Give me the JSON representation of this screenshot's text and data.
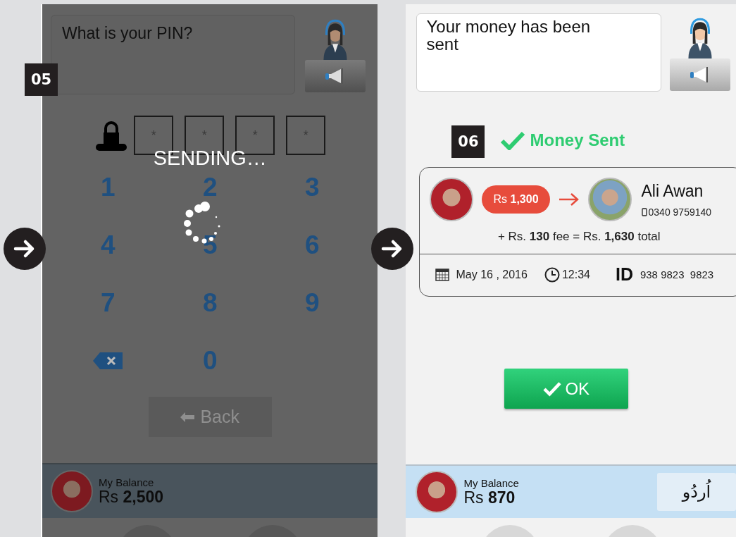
{
  "pin_screen": {
    "step": "05",
    "loading": true,
    "loading_text": "SENDING…",
    "message": "What is your PIN?",
    "pin_digits": [
      "*",
      "*",
      "*",
      "*"
    ],
    "keypad": [
      {
        "kind": "digit",
        "label": "1"
      },
      {
        "kind": "digit",
        "label": "2"
      },
      {
        "kind": "digit",
        "label": "3"
      },
      {
        "kind": "digit",
        "label": "4"
      },
      {
        "kind": "digit",
        "label": "5"
      },
      {
        "kind": "digit",
        "label": "6"
      },
      {
        "kind": "digit",
        "label": "7"
      },
      {
        "kind": "digit",
        "label": "8"
      },
      {
        "kind": "digit",
        "label": "9"
      },
      {
        "kind": "delete"
      },
      {
        "kind": "digit",
        "label": "0"
      }
    ],
    "back_button": {
      "label": "Back",
      "disabled": true
    },
    "balance": {
      "label": "My Balance",
      "amount": "Rs **2,500**"
    }
  },
  "confirmation_screen": {
    "step": "06",
    "message": "Your money has been sent",
    "status": "Money Sent",
    "transfer": {
      "amount": "Rs **1,300**",
      "recipient_name": "Ali Awan",
      "recipient_phone": "0340 9759140",
      "fee_line": "+ Rs. **130** fee = Rs. **1,630** total",
      "date": "May 16 , 2016",
      "time": "12:34",
      "id_label": "ID",
      "id_value": "938 9823  9823"
    },
    "ok_button": {
      "label": "OK"
    },
    "balance": {
      "label": "My Balance",
      "amount": "Rs **870**"
    },
    "language_button": {
      "label": "اُردُو"
    }
  }
}
